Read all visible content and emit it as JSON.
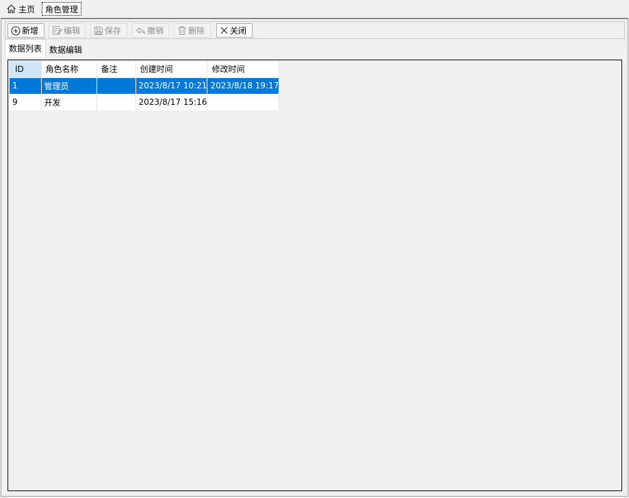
{
  "page_tabs": {
    "home": {
      "label": "主页",
      "icon": "home-icon"
    },
    "active": {
      "label": "角色管理"
    }
  },
  "toolbar": {
    "add": {
      "label": "新增",
      "icon": "plus-circle-icon",
      "enabled": true
    },
    "edit": {
      "label": "编辑",
      "icon": "edit-icon",
      "enabled": false
    },
    "save": {
      "label": "保存",
      "icon": "save-icon",
      "enabled": false
    },
    "undo": {
      "label": "撤销",
      "icon": "undo-icon",
      "enabled": false
    },
    "delete": {
      "label": "删除",
      "icon": "trash-icon",
      "enabled": false
    },
    "close": {
      "label": "关闭",
      "icon": "close-icon",
      "enabled": true
    }
  },
  "tabs": [
    {
      "label": "数据列表",
      "selected": true
    },
    {
      "label": "数据编辑",
      "selected": false
    }
  ],
  "grid": {
    "columns": [
      "ID",
      "角色名称",
      "备注",
      "创建时间",
      "修改时间"
    ],
    "rows": [
      {
        "id": "1",
        "name": "管理员",
        "remark": "",
        "created": "2023/8/17 10:21",
        "modified": "2023/8/18 19:17",
        "selected": true
      },
      {
        "id": "9",
        "name": "开发",
        "remark": "",
        "created": "2023/8/17 15:16",
        "modified": "",
        "selected": false
      }
    ]
  },
  "colors": {
    "selection": "#0078d7",
    "header_highlight": "#cfe6f7",
    "disabled_text": "#8d8d8d"
  }
}
